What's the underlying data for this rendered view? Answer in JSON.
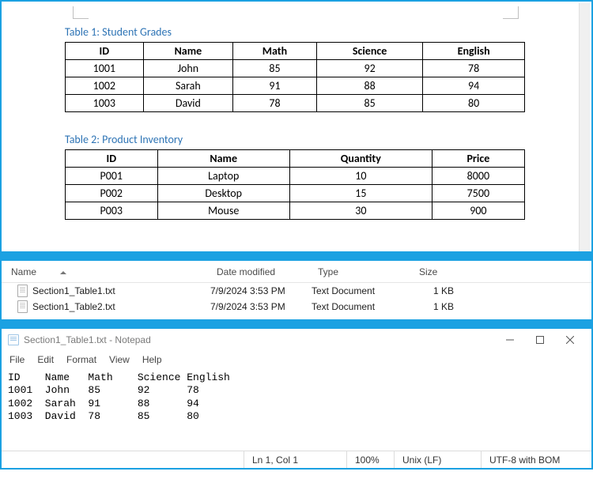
{
  "doc": {
    "table1": {
      "title": "Table 1: Student Grades",
      "headers": [
        "ID",
        "Name",
        "Math",
        "Science",
        "English"
      ],
      "rows": [
        [
          "1001",
          "John",
          "85",
          "92",
          "78"
        ],
        [
          "1002",
          "Sarah",
          "91",
          "88",
          "94"
        ],
        [
          "1003",
          "David",
          "78",
          "85",
          "80"
        ]
      ]
    },
    "table2": {
      "title": "Table 2: Product Inventory",
      "headers": [
        "ID",
        "Name",
        "Quantity",
        "Price"
      ],
      "rows": [
        [
          "P001",
          "Laptop",
          "10",
          "8000"
        ],
        [
          "P002",
          "Desktop",
          "15",
          "7500"
        ],
        [
          "P003",
          "Mouse",
          "30",
          "900"
        ]
      ]
    }
  },
  "explorer": {
    "columns": {
      "name": "Name",
      "date": "Date modified",
      "type": "Type",
      "size": "Size"
    },
    "rows": [
      {
        "name": "Section1_Table1.txt",
        "date": "7/9/2024 3:53 PM",
        "type": "Text Document",
        "size": "1 KB"
      },
      {
        "name": "Section1_Table2.txt",
        "date": "7/9/2024 3:53 PM",
        "type": "Text Document",
        "size": "1 KB"
      }
    ]
  },
  "notepad": {
    "title": "Section1_Table1.txt - Notepad",
    "menu": [
      "File",
      "Edit",
      "Format",
      "View",
      "Help"
    ],
    "content": "ID    Name   Math    Science English\n1001  John   85      92      78\n1002  Sarah  91      88      94\n1003  David  78      85      80",
    "status": {
      "cursor": "Ln 1, Col 1",
      "zoom": "100%",
      "eol": "Unix (LF)",
      "encoding": "UTF-8 with BOM"
    }
  }
}
